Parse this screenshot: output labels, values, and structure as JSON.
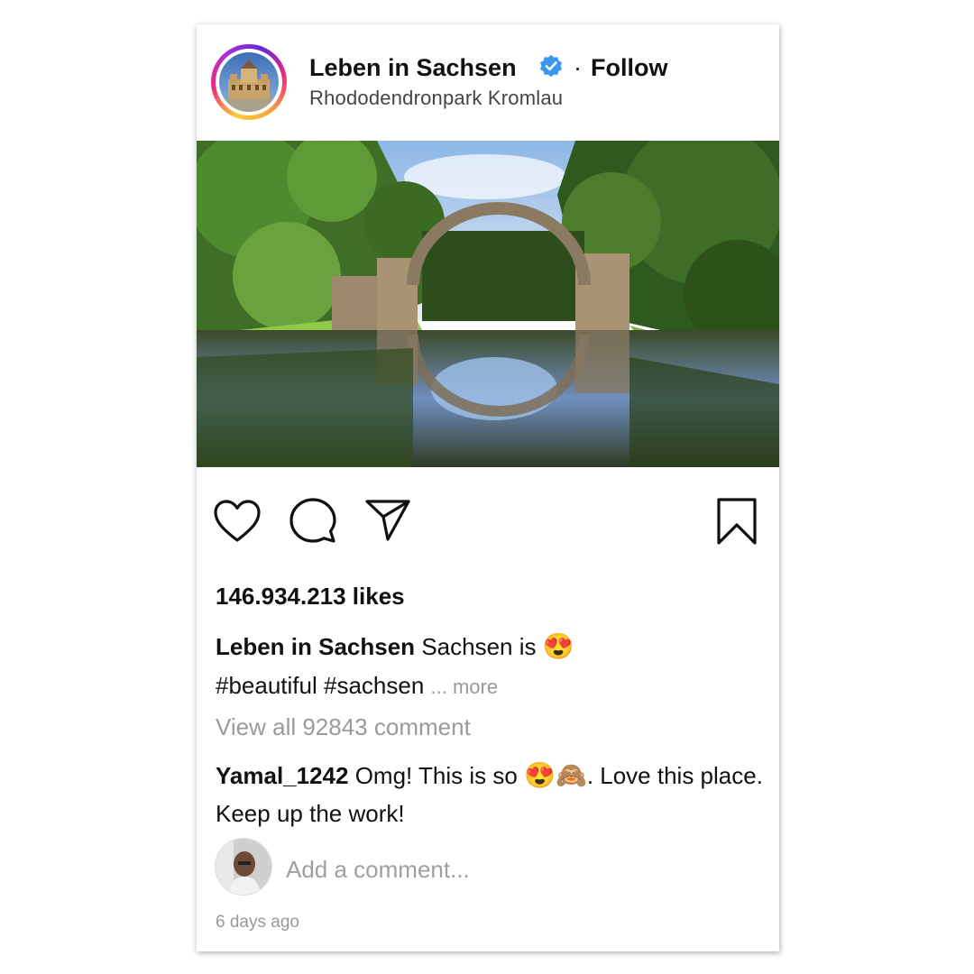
{
  "post": {
    "account_name": "Leben in Sachsen",
    "separator": "·",
    "follow_label": "Follow",
    "location": "Rhododendronpark Kromlau",
    "likes": "146.934.213 likes",
    "caption": {
      "author": "Leben in Sachsen",
      "text": "Sachsen is",
      "emoji": "😍",
      "hashtags": "#beautiful #sachsen",
      "more_label": "... more"
    },
    "view_all_comments": "View all 92843 comment",
    "comment": {
      "author": "Yamal_1242",
      "text_before": "Omg! This is so",
      "emoji_1": "😍",
      "emoji_2": "🙈",
      "text_after": ". Love this place. Keep up the work!"
    },
    "add_comment_placeholder": "Add a comment...",
    "timestamp": "6 days ago"
  },
  "icons": {
    "verified": "verified-badge-icon",
    "like": "heart-icon",
    "comment": "comment-bubble-icon",
    "share": "paper-plane-icon",
    "save": "bookmark-icon"
  },
  "colors": {
    "verified_blue": "#3897f0",
    "text": "#111111",
    "muted": "#999999"
  }
}
